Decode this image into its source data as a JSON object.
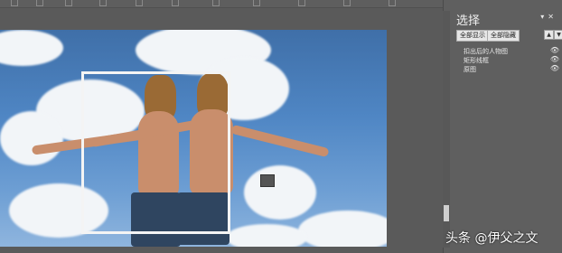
{
  "selection_pane": {
    "title": "选择",
    "show_all_label": "全部显示",
    "hide_all_label": "全部隐藏",
    "bring_forward_icon": "triangle-up-icon",
    "send_backward_icon": "triangle-down-icon",
    "dropdown_icon": "triangle-down-icon",
    "close_icon": "close-icon",
    "layers": [
      {
        "label": "扣出后的人物图",
        "visibility_icon": "eye-icon"
      },
      {
        "label": "矩形线框",
        "visibility_icon": "eye-icon"
      },
      {
        "label": "原图",
        "visibility_icon": "eye-icon"
      }
    ]
  },
  "watermark": {
    "text": "头条 @伊父之文"
  },
  "colors": {
    "pane_bg": "#5f5f5f",
    "workspace_bg": "#5a5a5a",
    "frame": "#f4f4f4"
  }
}
